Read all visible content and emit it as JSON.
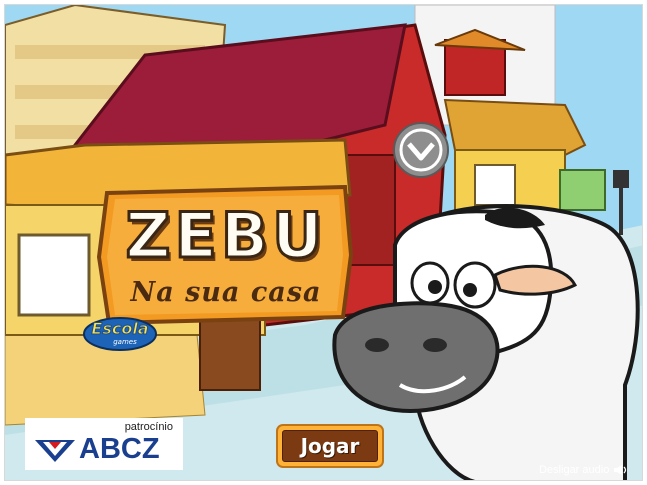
{
  "game": {
    "title": "ZEBU",
    "subtitle": "Na sua casa"
  },
  "publisher": {
    "name": "Escola",
    "tagline": "games"
  },
  "sponsor": {
    "label": "patrocínio",
    "name": "ABCZ"
  },
  "controls": {
    "play_label": "Jogar",
    "audio_label": "Desligar audio"
  },
  "icons": {
    "brand": "brand-badge-icon",
    "sponsor_logo": "abcz-logo-icon",
    "audio": "speaker-icon"
  },
  "colors": {
    "sky": "#8fd0ef",
    "title_board": "#f39a22",
    "play_button": "#7b3a12",
    "play_border": "#ffb238",
    "sponsor_blue": "#1a3f8f",
    "sponsor_red": "#d71920"
  }
}
